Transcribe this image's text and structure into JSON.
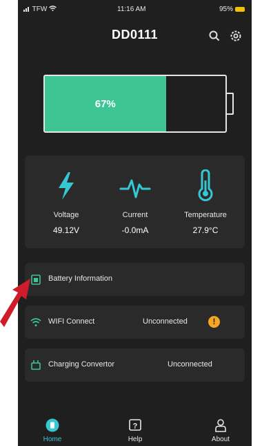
{
  "status_bar": {
    "carrier": "TFW",
    "time": "11:16 AM",
    "battery": "95%"
  },
  "header": {
    "title": "DD0111",
    "icons": [
      "search-icon",
      "gear-icon"
    ]
  },
  "battery": {
    "level": 0.67,
    "percent_label": "67%",
    "fill_color": "#3ec595"
  },
  "metrics": [
    {
      "label": "Voltage",
      "value": "49.12V",
      "icon": "lightning-icon"
    },
    {
      "label": "Current",
      "value": "-0.0mA",
      "icon": "pulse-icon"
    },
    {
      "label": "Temperature",
      "value": "27.9°C",
      "icon": "thermometer-icon"
    }
  ],
  "rows": {
    "battery_info": {
      "label": "Battery Information",
      "icon": "battery-info-icon"
    },
    "wifi": {
      "label": "WIFI Connect",
      "status": "Unconnected",
      "icon": "wifi-icon",
      "warning": "!"
    },
    "charging": {
      "label": "Charging Convertor",
      "status": "Unconnected",
      "icon": "plug-icon"
    }
  },
  "tabs": [
    {
      "label": "Home",
      "icon": "home-icon",
      "active": true
    },
    {
      "label": "Help",
      "icon": "help-icon",
      "active": false
    },
    {
      "label": "About",
      "icon": "user-icon",
      "active": false
    }
  ],
  "colors": {
    "accent": "#3ec595",
    "icon_accent": "#35c8d4",
    "background": "#1f1f1f",
    "card": "#2a2a2a",
    "warning": "#f5a623",
    "annotation_arrow": "#d01c2a"
  }
}
